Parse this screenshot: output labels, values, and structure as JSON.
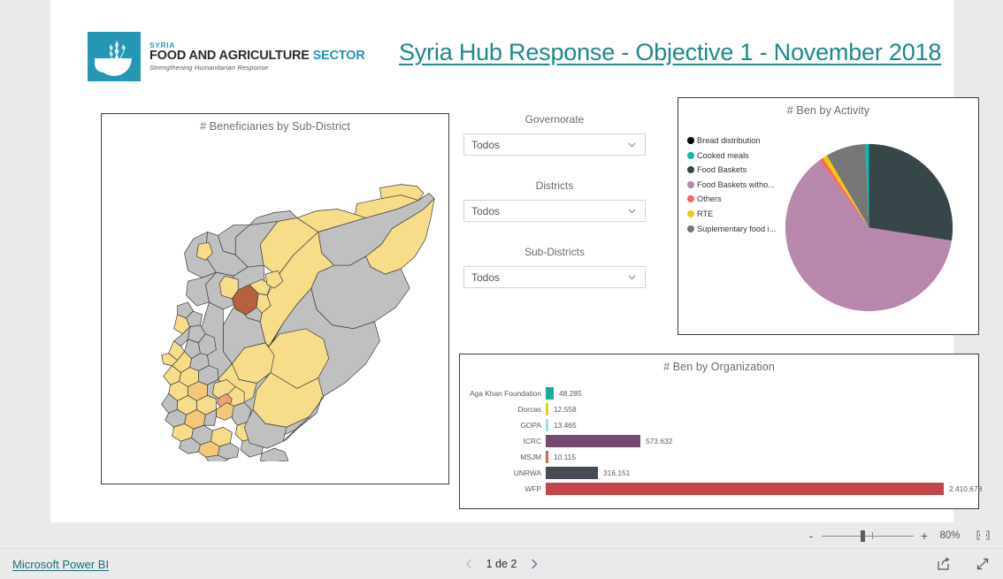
{
  "window": {
    "page_background": "#e9e9e9",
    "canvas_background": "#ffffff"
  },
  "header": {
    "logo": {
      "icon": "wheat-bowl-icon",
      "brand_country": "SYRIA",
      "brand_main_1": "FOOD AND AGRICULTURE ",
      "brand_main_2": "SECTOR",
      "brand_tagline": "Strengthening Humanitarian Response",
      "brand_color": "#2397b3"
    },
    "title": "Syria Hub Response - Objective 1 - November 2018",
    "title_color": "#1a8a8a"
  },
  "map_visual": {
    "title": "# Beneficiaries by Sub-District",
    "legend_colors": {
      "no_data": "#c0c0c0",
      "low": "#f7dc8a",
      "mid": "#f5c77a",
      "high": "#f2a07a",
      "highest": "#b5603f"
    }
  },
  "slicers": [
    {
      "label": "Governorate",
      "value": "Todos",
      "icon": "chevron-down-icon"
    },
    {
      "label": "Districts",
      "value": "Todos",
      "icon": "chevron-down-icon"
    },
    {
      "label": "Sub-Districts",
      "value": "Todos",
      "icon": "chevron-down-icon"
    }
  ],
  "chart_data": [
    {
      "type": "pie",
      "title": "# Ben by Activity",
      "legend_position": "left",
      "categories": [
        "Bread distribution",
        "Cooked meals",
        "Food Baskets",
        "Food Baskets witho...",
        "Others",
        "RTE",
        "Suplementary food i..."
      ],
      "colors": [
        "#000000",
        "#12b5b0",
        "#374649",
        "#b887ac",
        "#fd625e",
        "#f2c80f",
        "#767676"
      ],
      "values": [
        0.0,
        0.7,
        27.5,
        62.5,
        0.7,
        0.9,
        7.7
      ],
      "value_unit": "percent"
    },
    {
      "type": "bar",
      "title": "# Ben by Organization",
      "orientation": "horizontal",
      "categories": [
        "Aga Khan Foundation",
        "Dorcas",
        "GOPA",
        "ICRC",
        "MSJM",
        "UNRWA",
        "WFP"
      ],
      "values": [
        48285,
        12558,
        13465,
        573632,
        10115,
        316151,
        2410678
      ],
      "value_labels": [
        "48.285",
        "12.558",
        "13.465",
        "573.632",
        "10.115",
        "316.151",
        "2.410.678"
      ],
      "colors": [
        "#1aab9b",
        "#f2c80f",
        "#a5d8f3",
        "#74496f",
        "#c96b4a",
        "#444b52",
        "#c44545"
      ],
      "xlim": [
        0,
        2410678
      ],
      "grid": false,
      "xlabel": "",
      "ylabel": ""
    }
  ],
  "zoom_bar": {
    "minus_label": "-",
    "plus_label": "+",
    "percent": "80%",
    "fit_icon": "fit-to-page-icon"
  },
  "footer": {
    "powerbi_link": "Microsoft Power BI",
    "prev_icon": "chevron-left-icon",
    "page_label": "1 de 2",
    "next_icon": "chevron-right-icon",
    "share_icon": "share-icon",
    "fullscreen_icon": "fullscreen-icon"
  }
}
